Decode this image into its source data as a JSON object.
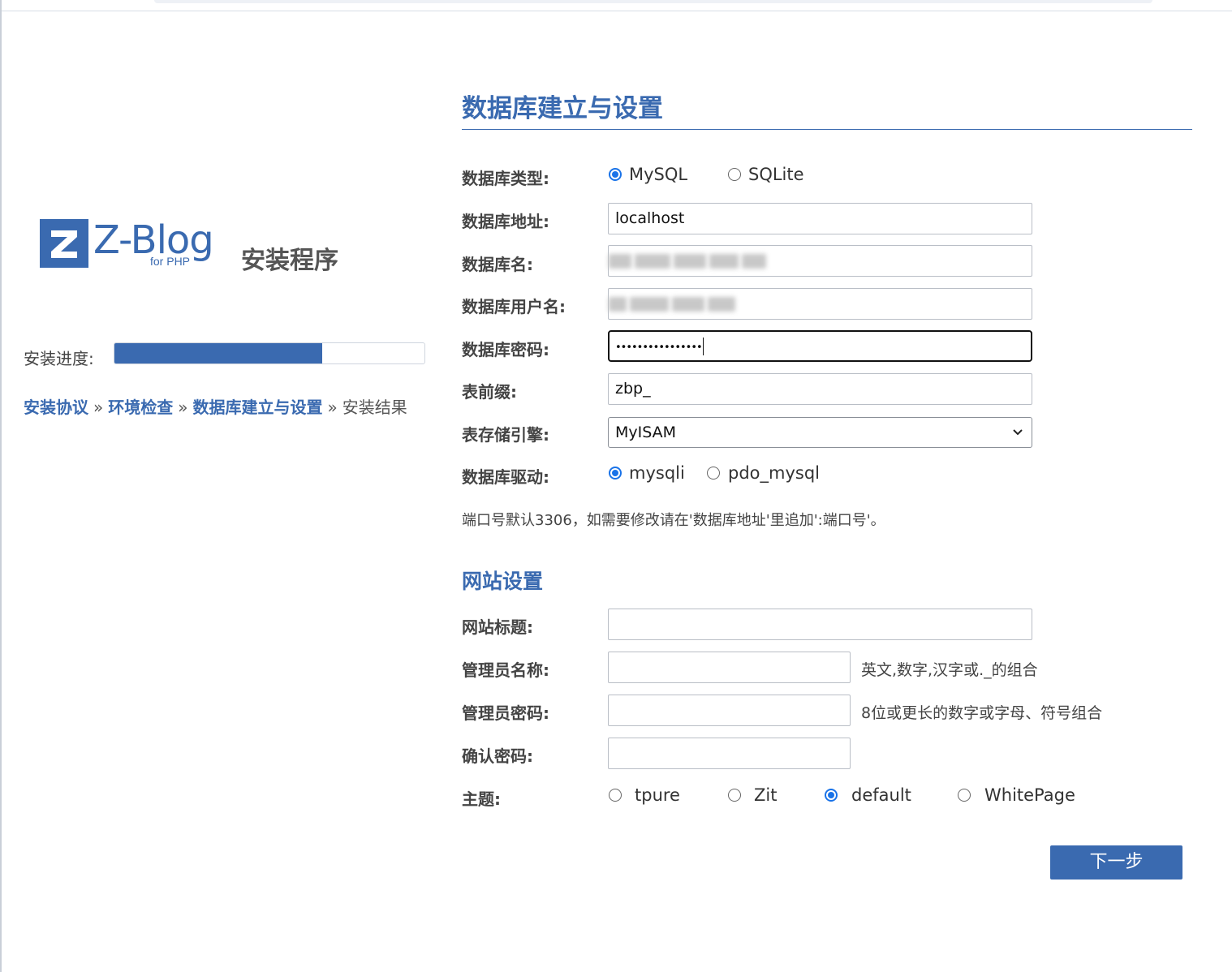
{
  "logo": {
    "word": "Z-Blog",
    "sub": "for PHP",
    "title": "安装程序"
  },
  "progress": {
    "label": "安装进度:",
    "percent": 67
  },
  "steps": [
    {
      "label": "安装协议",
      "done": true
    },
    {
      "label": "环境检查",
      "done": true
    },
    {
      "label": "数据库建立与设置",
      "done": true
    },
    {
      "label": "安装结果",
      "done": false
    }
  ],
  "steps_separator": "»",
  "db": {
    "title": "数据库建立与设置",
    "type_label": "数据库类型:",
    "type_options": [
      "MySQL",
      "SQLite"
    ],
    "type_selected": "MySQL",
    "host_label": "数据库地址:",
    "host_value": "localhost",
    "name_label": "数据库名:",
    "user_label": "数据库用户名:",
    "password_label": "数据库密码:",
    "password_value": "••••••••••••••••",
    "prefix_label": "表前缀:",
    "prefix_value": "zbp_",
    "engine_label": "表存储引擎:",
    "engine_value": "MyISAM",
    "driver_label": "数据库驱动:",
    "driver_options": [
      "mysqli",
      "pdo_mysql"
    ],
    "driver_selected": "mysqli",
    "note": "端口号默认3306，如需要修改请在'数据库地址'里追加':端口号'。"
  },
  "site": {
    "title": "网站设置",
    "site_title_label": "网站标题:",
    "admin_name_label": "管理员名称:",
    "admin_name_hint": "英文,数字,汉字或._的组合",
    "admin_pwd_label": "管理员密码:",
    "admin_pwd_hint": "8位或更长的数字或字母、符号组合",
    "confirm_label": "确认密码:",
    "theme_label": "主题:",
    "theme_options": [
      "tpure",
      "Zit",
      "default",
      "WhitePage"
    ],
    "theme_selected": "default"
  },
  "next_button": "下一步"
}
